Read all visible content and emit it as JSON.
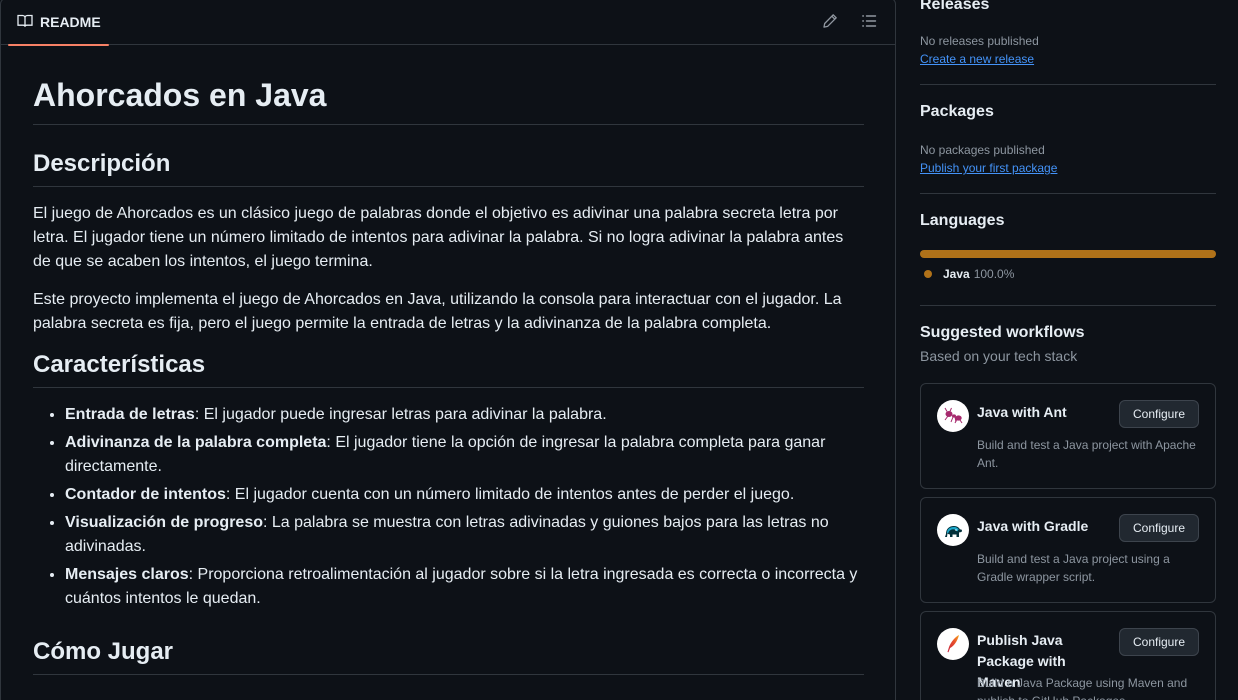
{
  "readme": {
    "tab_label": "README",
    "icons": {
      "tab": "book-icon",
      "edit": "pencil-icon",
      "toc": "list-icon"
    },
    "title": "Ahorcados en Java",
    "sections": {
      "descripcion": {
        "heading": "Descripción",
        "paragraphs": [
          "El juego de Ahorcados es un clásico juego de palabras donde el objetivo es adivinar una palabra secreta letra por letra. El jugador tiene un número limitado de intentos para adivinar la palabra. Si no logra adivinar la palabra antes de que se acaben los intentos, el juego termina.",
          "Este proyecto implementa el juego de Ahorcados en Java, utilizando la consola para interactuar con el jugador. La palabra secreta es fija, pero el juego permite la entrada de letras y la adivinanza de la palabra completa."
        ]
      },
      "caracteristicas": {
        "heading": "Características",
        "items": [
          {
            "bold": "Entrada de letras",
            "text": ": El jugador puede ingresar letras para adivinar la palabra."
          },
          {
            "bold": "Adivinanza de la palabra completa",
            "text": ": El jugador tiene la opción de ingresar la palabra completa para ganar directamente."
          },
          {
            "bold": "Contador de intentos",
            "text": ": El jugador cuenta con un número limitado de intentos antes de perder el juego."
          },
          {
            "bold": "Visualización de progreso",
            "text": ": La palabra se muestra con letras adivinadas y guiones bajos para las letras no adivinadas."
          },
          {
            "bold": "Mensajes claros",
            "text": ": Proporciona retroalimentación al jugador sobre si la letra ingresada es correcta o incorrecta y cuántos intentos le quedan."
          }
        ]
      },
      "como_jugar": {
        "heading": "Cómo Jugar"
      }
    }
  },
  "sidebar": {
    "releases": {
      "title": "Releases",
      "empty_text": "No releases published",
      "link": "Create a new release"
    },
    "packages": {
      "title": "Packages",
      "empty_text": "No packages published",
      "link": "Publish your first package"
    },
    "languages": {
      "title": "Languages",
      "items": [
        {
          "name": "Java",
          "percent": "100.0%",
          "share": 1.0,
          "color": "#b07219"
        }
      ]
    },
    "workflows": {
      "title": "Suggested workflows",
      "subtitle": "Based on your tech stack",
      "items": [
        {
          "title": "Java with Ant",
          "description": "Build and test a Java project with Apache Ant.",
          "button": "Configure",
          "icon": "ant-icon"
        },
        {
          "title": "Java with Gradle",
          "description": "Build and test a Java project using a Gradle wrapper script.",
          "button": "Configure",
          "icon": "gradle-elephant-icon"
        },
        {
          "title": "Publish Java Package with Maven",
          "description": "Build a Java Package using Maven and publish to GitHub Packages.",
          "button": "Configure",
          "icon": "maven-feather-icon"
        }
      ]
    }
  },
  "colors": {
    "background": "#0d1117",
    "border": "#30363d",
    "text": "#e6edf3",
    "muted": "#8d96a0",
    "link": "#4493f8",
    "java": "#b07219",
    "tab_underline": "#f78166"
  }
}
